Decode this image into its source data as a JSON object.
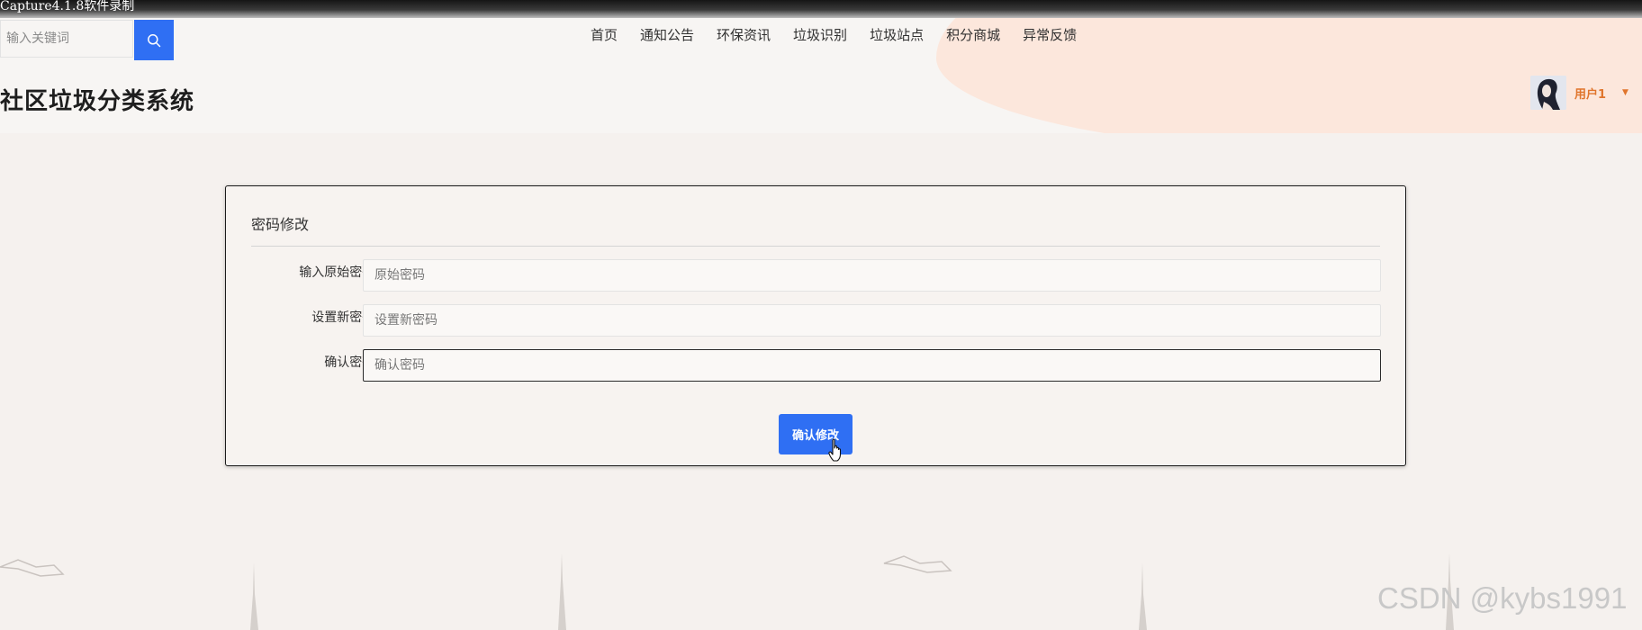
{
  "recorder": {
    "label": "Capture4.1.8软件录制"
  },
  "header": {
    "search": {
      "placeholder": "输入关键词"
    },
    "nav": [
      {
        "label": "首页"
      },
      {
        "label": "通知公告"
      },
      {
        "label": "环保资讯"
      },
      {
        "label": "垃圾识别"
      },
      {
        "label": "垃圾站点"
      },
      {
        "label": "积分商城"
      },
      {
        "label": "异常反馈"
      }
    ],
    "site_title": "社区垃圾分类系统",
    "user": {
      "name": "用户1",
      "caret": "▼"
    }
  },
  "panel": {
    "title": "密码修改",
    "fields": [
      {
        "label": "输入原始密码:",
        "placeholder": "原始密码",
        "value": ""
      },
      {
        "label": "设置新密码:",
        "placeholder": "设置新密码",
        "value": ""
      },
      {
        "label": "确认密码:",
        "placeholder": "确认密码",
        "value": ""
      }
    ],
    "submit_label": "确认修改"
  },
  "watermark": "CSDN @kybs1991",
  "colors": {
    "primary": "#2f6ff3",
    "accent_orange": "#e0752c",
    "header_blob": "#fce7dc"
  }
}
